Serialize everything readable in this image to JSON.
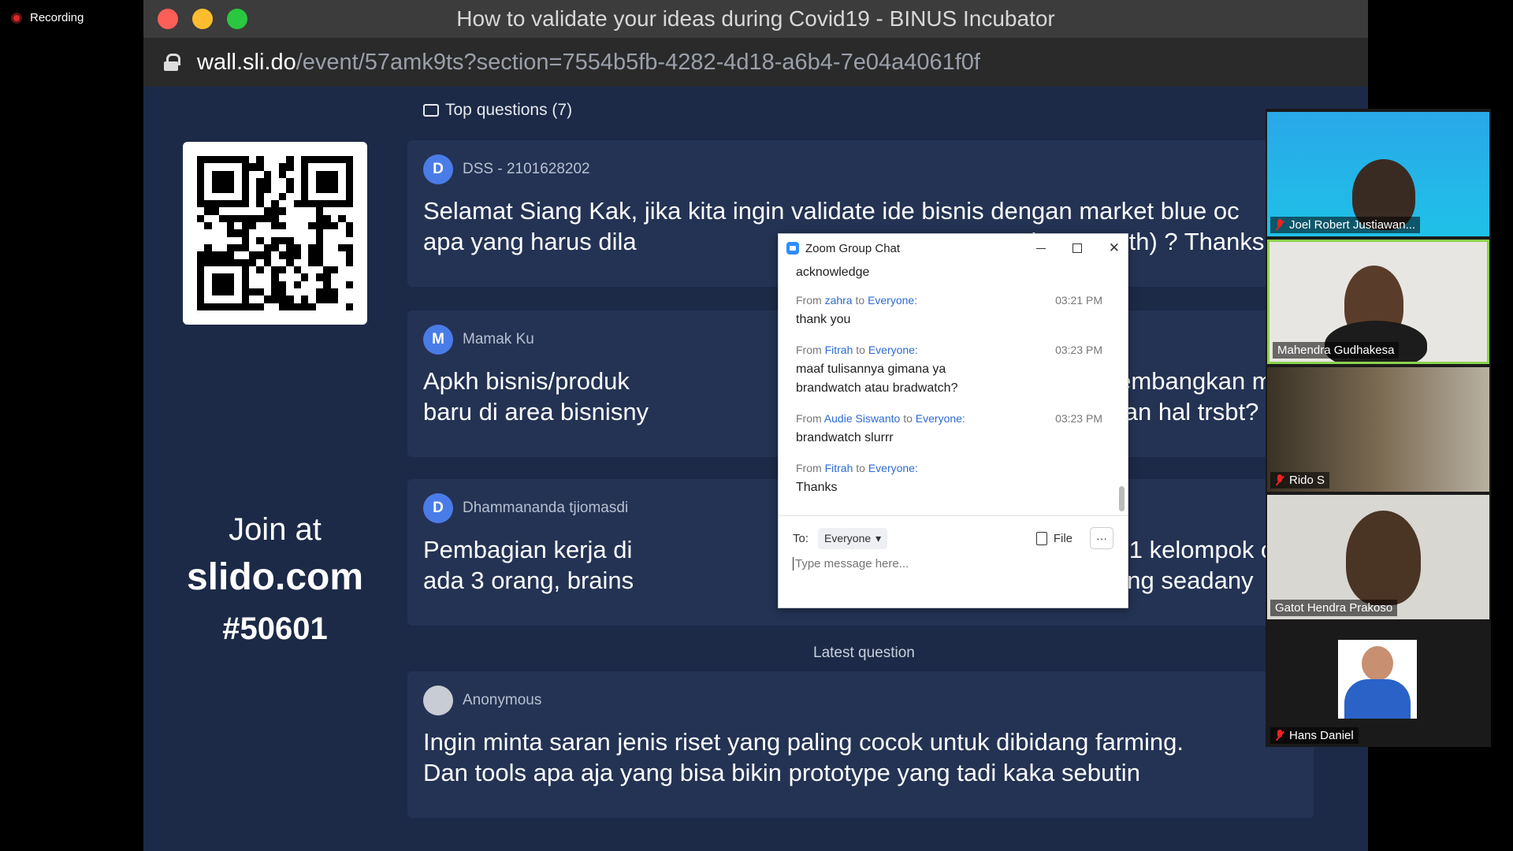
{
  "recording": {
    "label": "Recording"
  },
  "browser": {
    "title": "How to validate your ideas during Covid19 - BINUS Incubator",
    "url_host": "wall.sli.do",
    "url_path": "/event/57amk9ts?section=7554b5fb-4282-4d18-a6b4-7e04a4061f0f"
  },
  "slido": {
    "join_at": "Join at",
    "site": "slido.com",
    "code": "#50601",
    "top_questions_label": "Top questions (7)",
    "latest_label": "Latest question",
    "questions": [
      {
        "initial": "D",
        "author": "DSS - 2101628202",
        "line1": "Selamat Siang Kak, jika kita ingin validate ide bisnis dengan market blue oc",
        "line2": "apa yang harus dila",
        "line2b": "e (User Truth) ? Thanks."
      },
      {
        "initial": "M",
        "author": "Mamak Ku",
        "line1": "Apkh bisnis/produk",
        "line1b": "ptakan/mengembangkan ma",
        "line2": "baru di area bisnisny",
        "line2b": "tk melaksnkan hal trsbt?"
      },
      {
        "initial": "D",
        "author": "Dhammananda tjiomasdi",
        "line1": "Pembagian kerja di",
        "line1b": "pak ? Misal 1 kelompok c",
        "line2": "ada 3 orang, brains",
        "line2b": "luas, cenderung seadany"
      }
    ],
    "latest": {
      "author": "Anonymous",
      "line1": "Ingin minta saran jenis riset yang paling cocok untuk dibidang farming.",
      "line2": "Dan tools apa aja yang bisa bikin prototype yang tadi kaka sebutin"
    }
  },
  "chat": {
    "title": "Zoom Group Chat",
    "first_text": "acknowledge",
    "messages": [
      {
        "from_label": "From",
        "sender": "zahra",
        "to_label": "to",
        "recipient": "Everyone:",
        "time": "03:21 PM",
        "text": "thank you"
      },
      {
        "from_label": "From",
        "sender": "Fitrah",
        "to_label": "to",
        "recipient": "Everyone:",
        "time": "03:23 PM",
        "text": "maaf tulisannya gimana ya brandwatch atau bradwatch?"
      },
      {
        "from_label": "From",
        "sender": "Audie Siswanto",
        "to_label": "to",
        "recipient": "Everyone:",
        "time": "03:23 PM",
        "text": "brandwatch slurrr"
      },
      {
        "from_label": "From",
        "sender": "Fitrah",
        "to_label": "to",
        "recipient": "Everyone:",
        "time": "",
        "text": "Thanks"
      }
    ],
    "to_label": "To:",
    "to_value": "Everyone",
    "file_label": "File",
    "more_label": "···",
    "input_placeholder": "Type message here..."
  },
  "participants": [
    {
      "name": "Joel Robert Justiawan...",
      "muted": true
    },
    {
      "name": "Mahendra Gudhakesa",
      "muted": false
    },
    {
      "name": "Rido S",
      "muted": true
    },
    {
      "name": "Gatot Hendra Prakoso",
      "muted": false
    },
    {
      "name": "Hans Daniel",
      "muted": true
    }
  ],
  "colors": {
    "accent": "#2d8cff",
    "active_speaker": "#8bd34a",
    "slido_bg": "#1c2a47",
    "mute": "#e22222"
  }
}
